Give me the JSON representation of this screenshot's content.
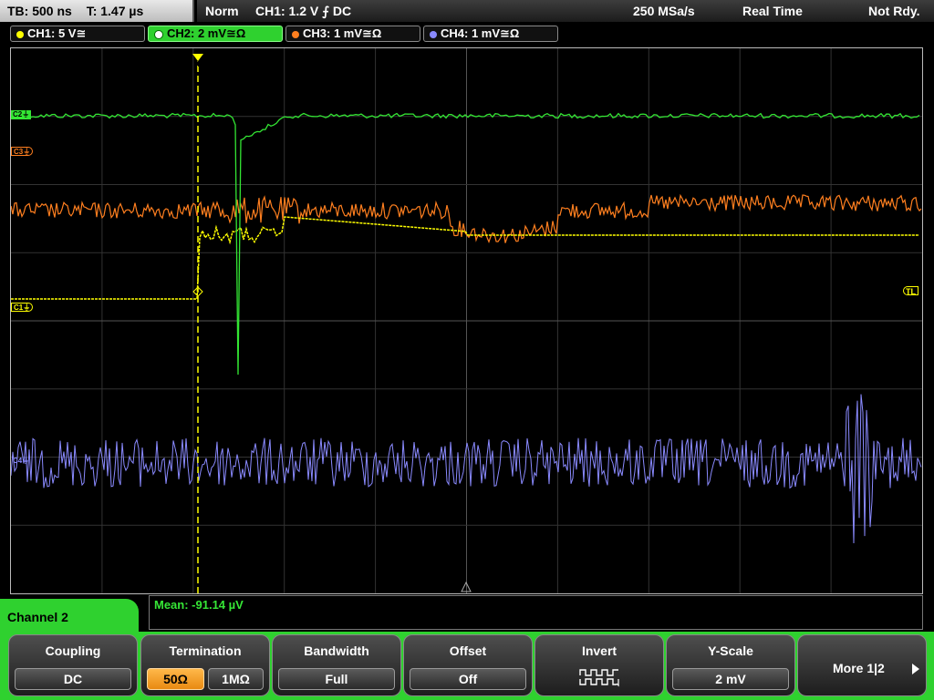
{
  "status": {
    "timebase": "TB: 500 ns",
    "trigger_time": "T: 1.47 µs",
    "mode": "Norm",
    "trigger_setting": "CH1: 1.2 V ⨍ DC",
    "sample_rate": "250 MSa/s",
    "acquisition": "Real Time",
    "state": "Not Rdy."
  },
  "channels": [
    {
      "label": "CH1: 5 V≅",
      "color": "#ffff00",
      "active": false
    },
    {
      "label": "CH2: 2 mV≅Ω",
      "color": "#33e633",
      "active": true
    },
    {
      "label": "CH3: 1 mV≅Ω",
      "color": "#ff7f1f",
      "active": false
    },
    {
      "label": "CH4: 1 mV≅Ω",
      "color": "#8a8aff",
      "active": false
    }
  ],
  "markers": {
    "c1": "C1⏚",
    "c2": "C2⏚",
    "c3": "C3⏚",
    "c4": "C4⏚",
    "trigger_level": "TL",
    "trigger_pos": "T"
  },
  "measurement": {
    "mean": "Mean: -91.14 µV"
  },
  "menu": {
    "channel_title": "Channel 2",
    "coupling": {
      "title": "Coupling",
      "value": "DC"
    },
    "termination": {
      "title": "Termination",
      "options": [
        "50Ω",
        "1MΩ"
      ],
      "selected": "50Ω"
    },
    "bandwidth": {
      "title": "Bandwidth",
      "value": "Full"
    },
    "offset": {
      "title": "Offset",
      "value": "Off"
    },
    "invert": {
      "title": "Invert"
    },
    "yscale": {
      "title": "Y-Scale",
      "value": "2 mV"
    },
    "more": {
      "label": "More 1|2"
    }
  }
}
